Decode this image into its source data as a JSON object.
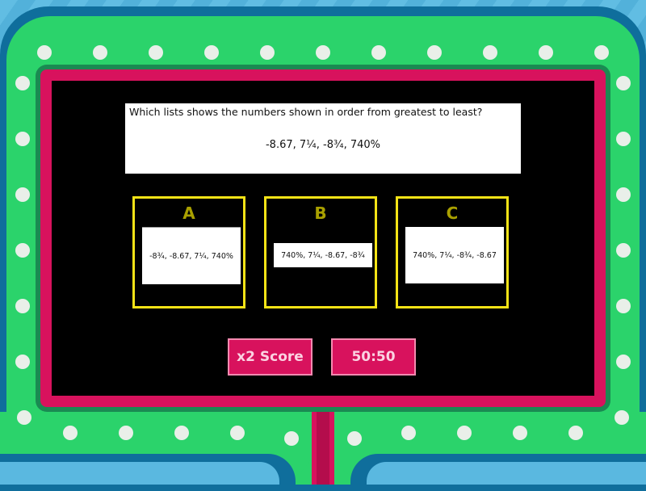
{
  "question": {
    "prompt": "Which lists shows the numbers shown in order from greatest to least?",
    "numbers": "-8.67, 7¼, -8¾, 740%"
  },
  "answers": [
    {
      "letter": "A",
      "text": "-8¾, -8.67, 7¼, 740%"
    },
    {
      "letter": "B",
      "text": "740%, 7¼, -8.67, -8¾"
    },
    {
      "letter": "C",
      "text": "740%, 7¼, -8¾, -8.67"
    }
  ],
  "powerups": {
    "double_score": "x2 Score",
    "fifty_fifty": "50:50"
  },
  "colors": {
    "board_green": "#2bd36b",
    "screen_border": "#d8125d",
    "card_border": "#f5e316",
    "letter": "#a9a000"
  }
}
